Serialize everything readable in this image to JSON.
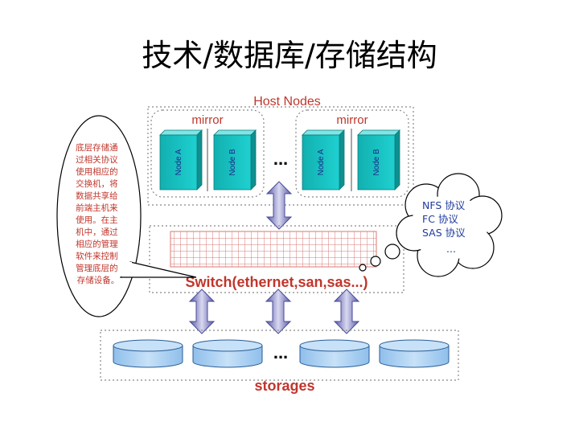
{
  "slide": {
    "title": "技术/数据库/存储结构"
  },
  "host": {
    "label": "Host Nodes",
    "groups": [
      {
        "label": "mirror",
        "nodes": [
          "Node A",
          "Node B"
        ]
      },
      {
        "label": "mirror",
        "nodes": [
          "Node A",
          "Node B"
        ]
      }
    ],
    "ellipsis": "..."
  },
  "switch": {
    "label": "Switch(ethernet,san,sas...)"
  },
  "storage": {
    "label": "storages",
    "ellipsis": "..."
  },
  "callout": {
    "lines": [
      "底层存储通",
      "过相关协议",
      "使用相应的",
      "交换机，将",
      "数据共享给",
      "前端主机来",
      "使用。在主",
      "机中，通过",
      "相应的管理",
      "软件来控制",
      "管理底层的",
      "存储设备。"
    ]
  },
  "protocols": {
    "lines": [
      "NFS 协议",
      "FC 协议",
      "SAS 协议",
      "..."
    ]
  },
  "colors": {
    "accent_red": "#c0362c",
    "node_teal": "#19c3c3",
    "arrow": "#7070b8",
    "disk": "#a8cdf0"
  }
}
